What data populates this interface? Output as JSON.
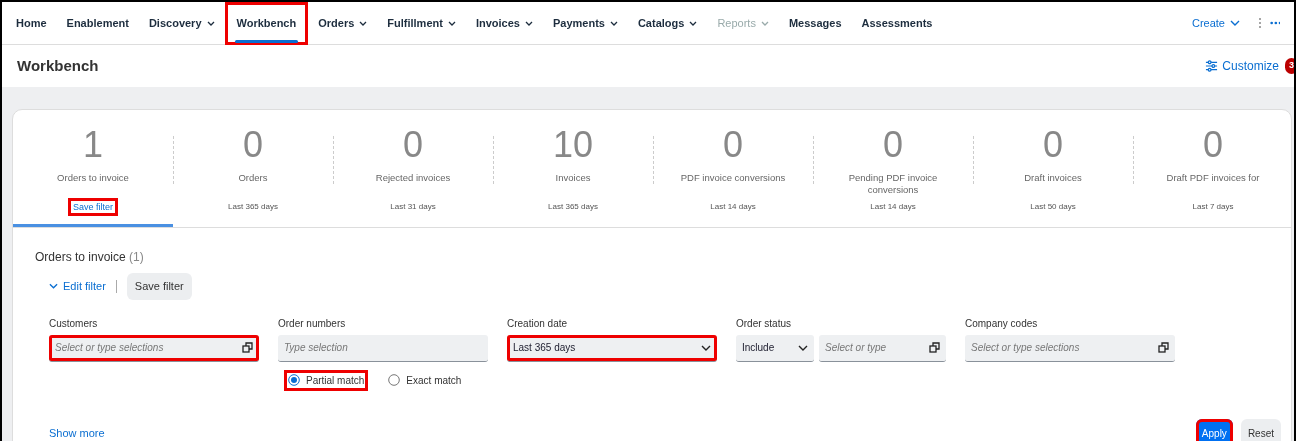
{
  "nav": {
    "items": [
      {
        "label": "Home",
        "caret": false,
        "selected": false,
        "disabled": false,
        "highlighted": false
      },
      {
        "label": "Enablement",
        "caret": false,
        "selected": false,
        "disabled": false,
        "highlighted": false
      },
      {
        "label": "Discovery",
        "caret": true,
        "selected": false,
        "disabled": false,
        "highlighted": false
      },
      {
        "label": "Workbench",
        "caret": false,
        "selected": true,
        "disabled": false,
        "highlighted": true
      },
      {
        "label": "Orders",
        "caret": true,
        "selected": false,
        "disabled": false,
        "highlighted": false
      },
      {
        "label": "Fulfillment",
        "caret": true,
        "selected": false,
        "disabled": false,
        "highlighted": false
      },
      {
        "label": "Invoices",
        "caret": true,
        "selected": false,
        "disabled": false,
        "highlighted": false
      },
      {
        "label": "Payments",
        "caret": true,
        "selected": false,
        "disabled": false,
        "highlighted": false
      },
      {
        "label": "Catalogs",
        "caret": true,
        "selected": false,
        "disabled": false,
        "highlighted": false
      },
      {
        "label": "Reports",
        "caret": true,
        "selected": false,
        "disabled": true,
        "highlighted": false
      },
      {
        "label": "Messages",
        "caret": false,
        "selected": false,
        "disabled": false,
        "highlighted": false
      },
      {
        "label": "Assessments",
        "caret": false,
        "selected": false,
        "disabled": false,
        "highlighted": false
      }
    ],
    "create": "Create"
  },
  "page": {
    "title": "Workbench",
    "customize": "Customize",
    "badge": "3"
  },
  "tiles": [
    {
      "count": "1",
      "label": "Orders to invoice",
      "action": "Save filter",
      "selected": true,
      "highlighted": true
    },
    {
      "count": "0",
      "label": "Orders",
      "period": "Last 365 days",
      "selected": false,
      "highlighted": false
    },
    {
      "count": "0",
      "label": "Rejected invoices",
      "period": "Last 31 days",
      "selected": false,
      "highlighted": false
    },
    {
      "count": "10",
      "label": "Invoices",
      "period": "Last 365 days",
      "selected": false,
      "highlighted": false
    },
    {
      "count": "0",
      "label": "PDF invoice conversions",
      "period": "Last 14 days",
      "selected": false,
      "highlighted": false
    },
    {
      "count": "0",
      "label": "Pending PDF invoice conversions",
      "period": "Last 14 days",
      "selected": false,
      "highlighted": false
    },
    {
      "count": "0",
      "label": "Draft invoices",
      "period": "Last 50 days",
      "selected": false,
      "highlighted": false
    },
    {
      "count": "0",
      "label": "Draft PDF invoices for",
      "period": "Last 7 days",
      "selected": false,
      "highlighted": false
    }
  ],
  "filter": {
    "title": "Orders to invoice",
    "count": "(1)",
    "edit_filter": "Edit filter",
    "save_filter": "Save filter",
    "fields": [
      {
        "kind": "valuehelp",
        "label": "Customers",
        "placeholder": "Select or type selections",
        "highlighted": true
      },
      {
        "kind": "text",
        "label": "Order numbers",
        "placeholder": "Type selection",
        "highlighted": false,
        "options": [
          {
            "label": "Partial match",
            "selected": true,
            "highlighted": true
          },
          {
            "label": "Exact match",
            "selected": false,
            "highlighted": false
          }
        ]
      },
      {
        "kind": "select",
        "label": "Creation date",
        "value": "Last 365 days",
        "highlighted": true
      },
      {
        "kind": "status",
        "label": "Order status",
        "value": "Include",
        "placeholder": "Select or type",
        "highlighted": false
      },
      {
        "kind": "valuehelp",
        "label": "Company codes",
        "placeholder": "Select or type selections",
        "highlighted": false
      }
    ],
    "show_more": "Show more",
    "buttons": [
      {
        "label": "Apply",
        "kind": "primary",
        "highlighted": true
      },
      {
        "label": "Reset",
        "kind": "secondary",
        "highlighted": false
      }
    ]
  }
}
